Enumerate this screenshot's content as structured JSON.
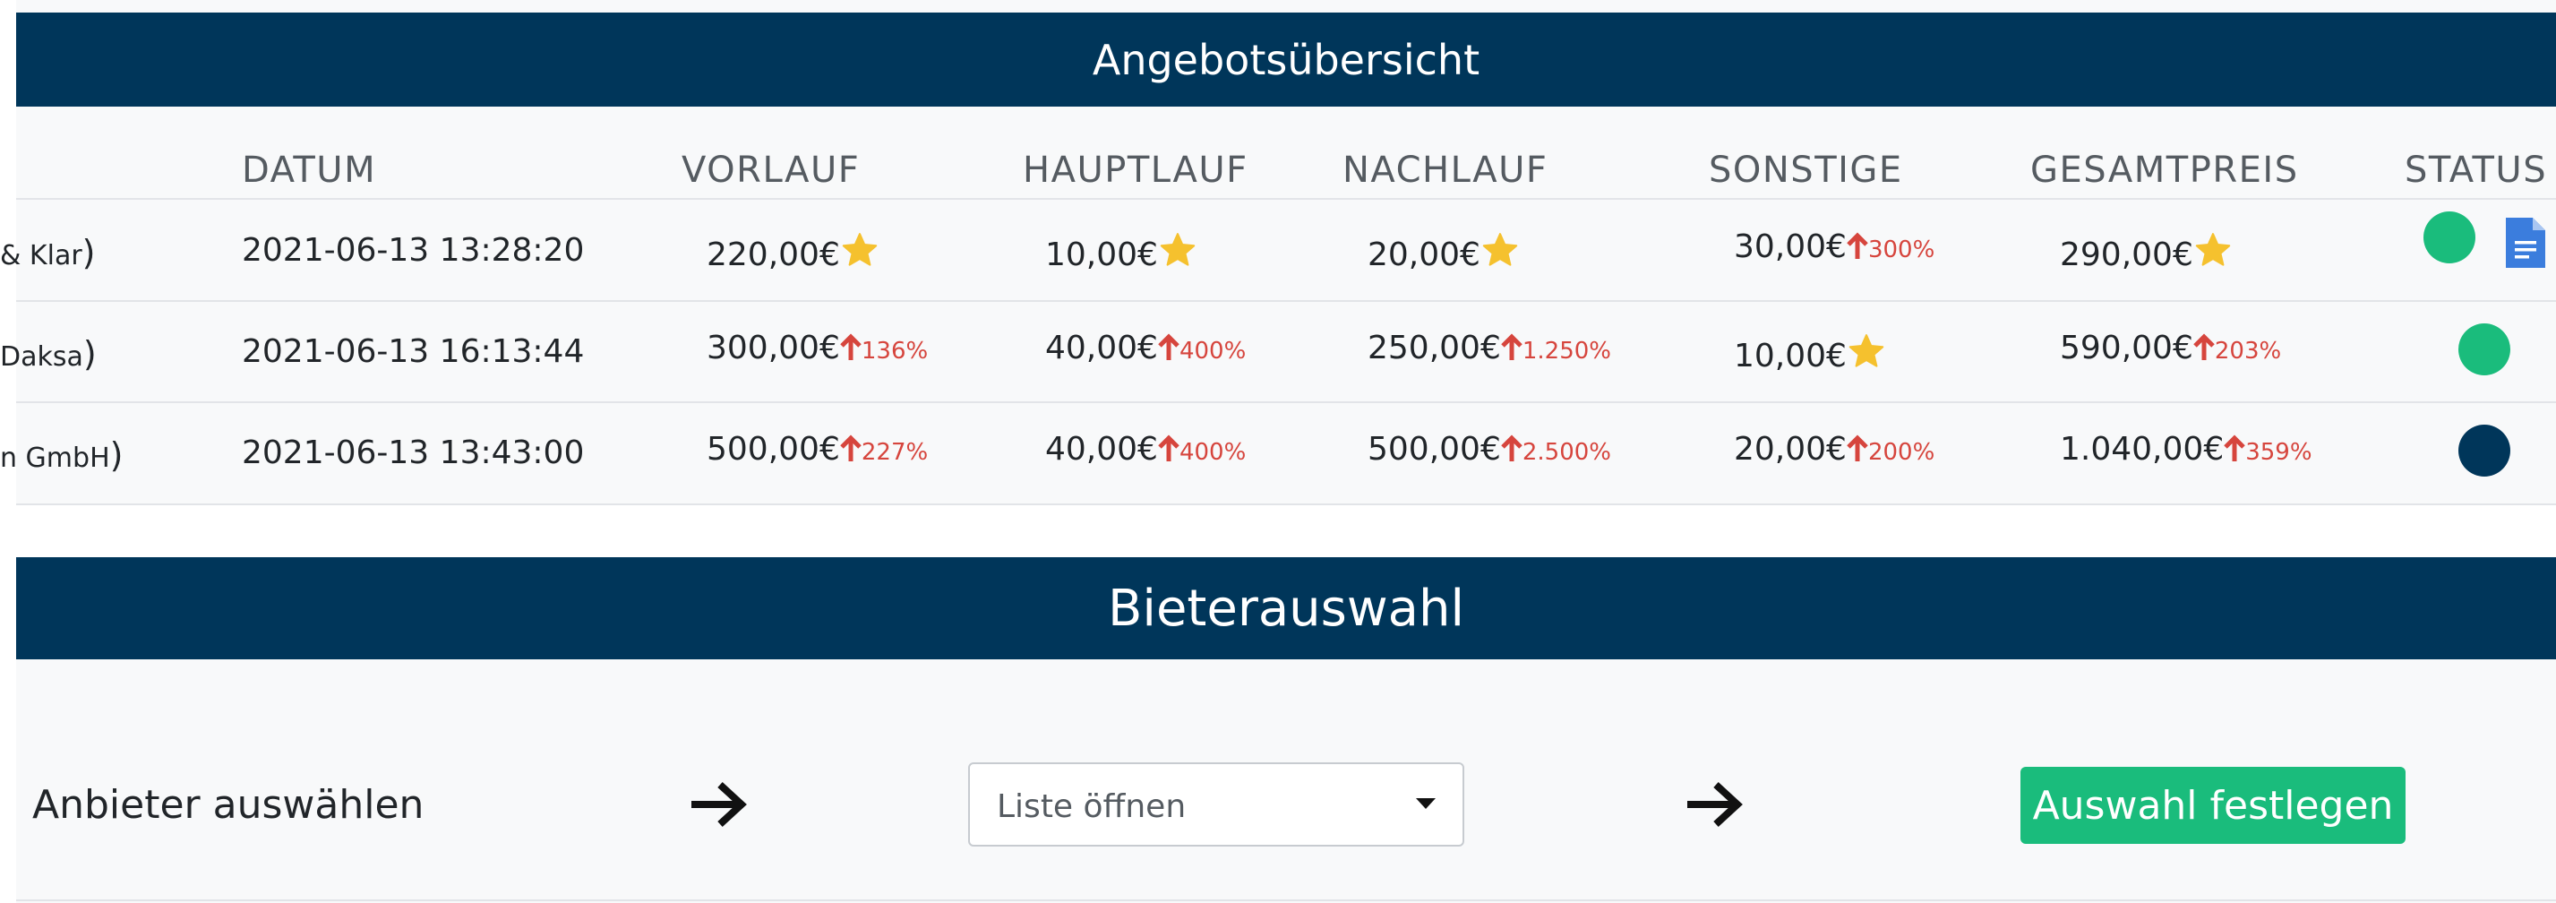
{
  "offers_section": {
    "title": "Angebotsübersicht",
    "columns": [
      "DATUM",
      "VORLAUF",
      "HAUPTLAUF",
      "NACHLAUF",
      "SONSTIGE",
      "GESAMTPREIS",
      "STATUS"
    ],
    "rows": [
      {
        "provider_fragment": "& Klar",
        "date": "2021-06-13 13:28:20",
        "vorlauf": {
          "price": "220,00€",
          "indicator": "star-icon",
          "pct": ""
        },
        "hauptlauf": {
          "price": "10,00€",
          "indicator": "star-icon",
          "pct": ""
        },
        "nachlauf": {
          "price": "20,00€",
          "indicator": "star-icon",
          "pct": ""
        },
        "sonstige": {
          "price": "30,00€",
          "indicator": "arrow-up-icon",
          "pct": "300%"
        },
        "gesamtpreis": {
          "price": "290,00€",
          "indicator": "star-icon",
          "pct": ""
        },
        "status_color": "#1abc7c",
        "has_document": true
      },
      {
        "provider_fragment": "Daksa",
        "date": "2021-06-13 16:13:44",
        "vorlauf": {
          "price": "300,00€",
          "indicator": "arrow-up-icon",
          "pct": "136%"
        },
        "hauptlauf": {
          "price": "40,00€",
          "indicator": "arrow-up-icon",
          "pct": "400%"
        },
        "nachlauf": {
          "price": "250,00€",
          "indicator": "arrow-up-icon",
          "pct": "1.250%"
        },
        "sonstige": {
          "price": "10,00€",
          "indicator": "star-icon",
          "pct": ""
        },
        "gesamtpreis": {
          "price": "590,00€",
          "indicator": "arrow-up-icon",
          "pct": "203%"
        },
        "status_color": "#1abc7c",
        "has_document": false
      },
      {
        "provider_fragment": "n GmbH",
        "date": "2021-06-13 13:43:00",
        "vorlauf": {
          "price": "500,00€",
          "indicator": "arrow-up-icon",
          "pct": "227%"
        },
        "hauptlauf": {
          "price": "40,00€",
          "indicator": "arrow-up-icon",
          "pct": "400%"
        },
        "nachlauf": {
          "price": "500,00€",
          "indicator": "arrow-up-icon",
          "pct": "2.500%"
        },
        "sonstige": {
          "price": "20,00€",
          "indicator": "arrow-up-icon",
          "pct": "200%"
        },
        "gesamtpreis": {
          "price": "1.040,00€",
          "indicator": "arrow-up-icon",
          "pct": "359%"
        },
        "status_color": "#00365a",
        "has_document": false
      }
    ]
  },
  "bidder_section": {
    "title": "Bieterauswahl",
    "label": "Anbieter auswählen",
    "select_text": "Liste öffnen",
    "button_label": "Auswahl festlegen"
  },
  "colors": {
    "header_bg": "#00365a",
    "accent_green": "#1abc7c",
    "up_red": "#d6453d",
    "star_yellow": "#f5c12e",
    "doc_blue": "#3b7ddd"
  }
}
